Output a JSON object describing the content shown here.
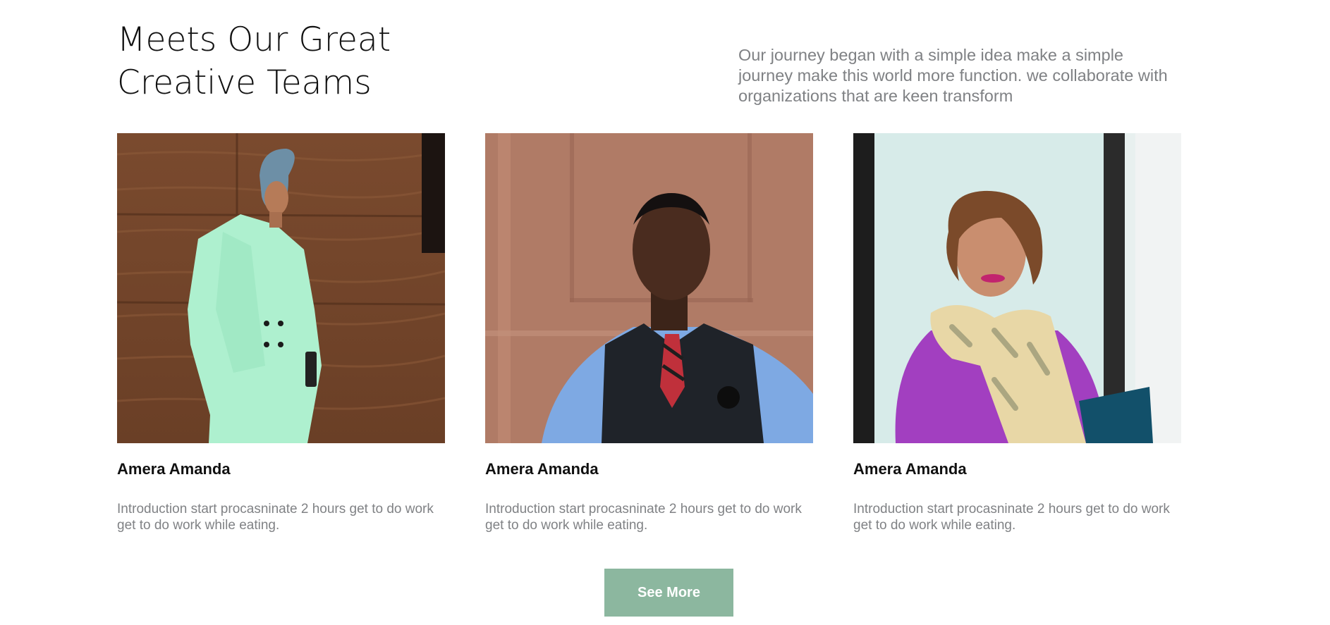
{
  "section": {
    "heading_line1": "Meets Our Great",
    "heading_line2": "Creative Teams",
    "intro": "Our journey began with a simple idea make a simple journey make this world more function. we collaborate with organizations that are keen transform"
  },
  "team": [
    {
      "name": "Amera Amanda",
      "description": "Introduction start procasninate 2 hours get to do work get to do work while eating.",
      "photo_icon": "person-photo-woman-mint-suit"
    },
    {
      "name": "Amera Amanda",
      "description": "Introduction start procasninate 2 hours get to do work get to do work while eating.",
      "photo_icon": "person-photo-man-vest"
    },
    {
      "name": "Amera Amanda",
      "description": "Introduction start procasninate 2 hours get to do work get to do work while eating.",
      "photo_icon": "person-photo-woman-scarf"
    }
  ],
  "actions": {
    "see_more_label": "See More"
  },
  "colors": {
    "accent": "#8cb79f",
    "body_text": "#808285",
    "heading_text": "#111111"
  }
}
